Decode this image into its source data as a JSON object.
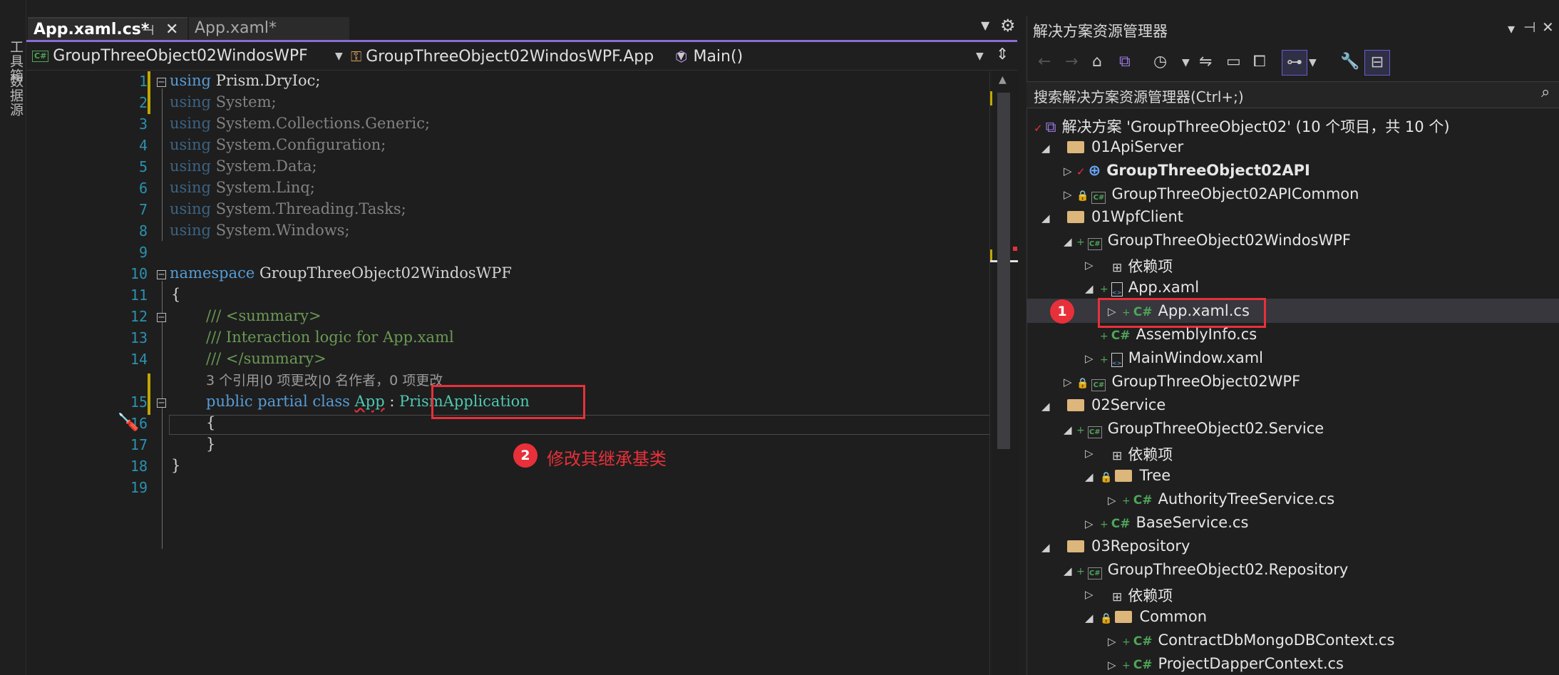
{
  "left_strip": {
    "toolbox": "工具箱",
    "datasource": "数据源"
  },
  "tabs": [
    {
      "label": "App.xaml.cs*",
      "active": true
    },
    {
      "label": "App.xaml*",
      "active": false
    }
  ],
  "navbar": {
    "project": "GroupThreeObject02WindosWPF",
    "class": "GroupThreeObject02WindosWPF.App",
    "member": "Main()"
  },
  "code": {
    "line_numbers": [
      "1",
      "2",
      "3",
      "4",
      "5",
      "6",
      "7",
      "8",
      "9",
      "10",
      "11",
      "12",
      "13",
      "14",
      "15",
      "16",
      "17",
      "18",
      "19"
    ],
    "using_kw": "using",
    "usings": [
      "Prism.DryIoc;",
      "System;",
      "System.Collections.Generic;",
      "System.Configuration;",
      "System.Data;",
      "System.Linq;",
      "System.Threading.Tasks;",
      "System.Windows;"
    ],
    "namespace_kw": "namespace",
    "namespace_name": "GroupThreeObject02WindosWPF",
    "open_brace": "{",
    "close_brace": "}",
    "summary_open": "/// <summary>",
    "summary_text": "/// Interaction logic for App.xaml",
    "summary_close": "/// </summary>",
    "codelens": "3 个引用|0 项更改|0 名作者，0 项更改",
    "class_decl_kw": "public partial class",
    "class_name": "App",
    "colon": ":",
    "base_class": "PrismApplication"
  },
  "annotations": {
    "step1": "1",
    "step2": "2",
    "step2_text": "修改其继承基类"
  },
  "solution_explorer": {
    "title": "解决方案资源管理器",
    "search_placeholder": "搜索解决方案资源管理器(Ctrl+;)",
    "solution": "解决方案 'GroupThreeObject02' (10 个项目，共 10 个)",
    "items": [
      "01ApiServer",
      "GroupThreeObject02API",
      "GroupThreeObject02APICommon",
      "01WpfClient",
      "GroupThreeObject02WindosWPF",
      "依赖项",
      "App.xaml",
      "App.xaml.cs",
      "AssemblyInfo.cs",
      "MainWindow.xaml",
      "GroupThreeObject02WPF",
      "02Service",
      "GroupThreeObject02.Service",
      "依赖项",
      "Tree",
      "AuthorityTreeService.cs",
      "BaseService.cs",
      "03Repository",
      "GroupThreeObject02.Repository",
      "依赖项",
      "Common",
      "ContractDbMongoDBContext.cs",
      "ProjectDapperContext.cs"
    ]
  },
  "colors": {
    "accent": "#8b6cd6",
    "annotation_red": "#e8303a",
    "keyword": "#569cd6",
    "type": "#4ec9b0",
    "comment": "#6a9955"
  }
}
